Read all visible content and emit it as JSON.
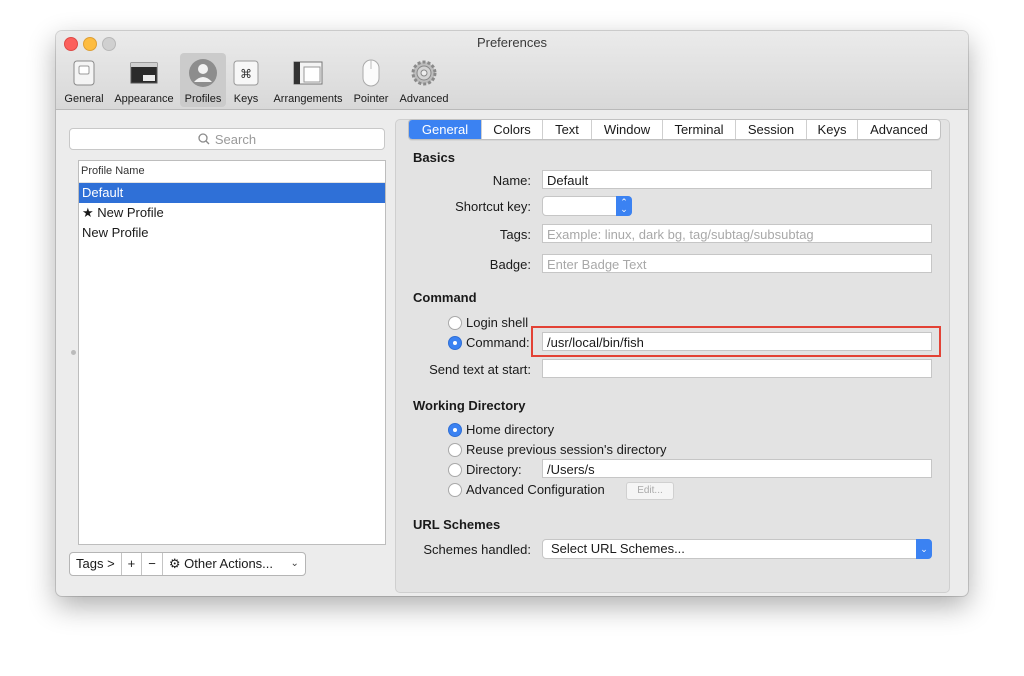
{
  "window": {
    "title": "Preferences"
  },
  "toolbar": [
    {
      "label": "General",
      "icon": "general-switch-icon"
    },
    {
      "label": "Appearance",
      "icon": "appearance-window-icon"
    },
    {
      "label": "Profiles",
      "icon": "profiles-person-icon",
      "selected": true
    },
    {
      "label": "Keys",
      "icon": "keys-command-icon"
    },
    {
      "label": "Arrangements",
      "icon": "arrangements-icon"
    },
    {
      "label": "Pointer",
      "icon": "pointer-mouse-icon"
    },
    {
      "label": "Advanced",
      "icon": "advanced-gear-icon"
    }
  ],
  "sidebar": {
    "search_placeholder": "Search",
    "list_header": "Profile Name",
    "profiles": [
      {
        "name": "Default",
        "selected": true
      },
      {
        "name": "★ New Profile",
        "selected": false
      },
      {
        "name": "New Profile",
        "selected": false
      }
    ],
    "bottom": {
      "tags": "Tags >",
      "add": "+",
      "remove": "−",
      "other_actions": "Other Actions..."
    }
  },
  "tabs": [
    "General",
    "Colors",
    "Text",
    "Window",
    "Terminal",
    "Session",
    "Keys",
    "Advanced"
  ],
  "active_tab": "General",
  "basics": {
    "heading": "Basics",
    "name_label": "Name:",
    "name_value": "Default",
    "shortcut_label": "Shortcut key:",
    "tags_label": "Tags:",
    "tags_placeholder": "Example: linux, dark bg, tag/subtag/subsubtag",
    "badge_label": "Badge:",
    "badge_placeholder": "Enter Badge Text"
  },
  "command": {
    "heading": "Command",
    "login_shell": "Login shell",
    "command_label": "Command:",
    "command_value": "/usr/local/bin/fish",
    "send_text_label": "Send text at start:",
    "send_text_value": ""
  },
  "working_directory": {
    "heading": "Working Directory",
    "home": "Home directory",
    "reuse": "Reuse previous session's directory",
    "directory_label": "Directory:",
    "directory_value": "/Users/s",
    "advanced_config": "Advanced Configuration",
    "edit_button": "Edit..."
  },
  "url_schemes": {
    "heading": "URL Schemes",
    "schemes_label": "Schemes handled:",
    "schemes_value": "Select URL Schemes..."
  },
  "colors": {
    "accent": "#3b82f2",
    "selection": "#2f70d7",
    "highlight_box": "#e34235"
  }
}
